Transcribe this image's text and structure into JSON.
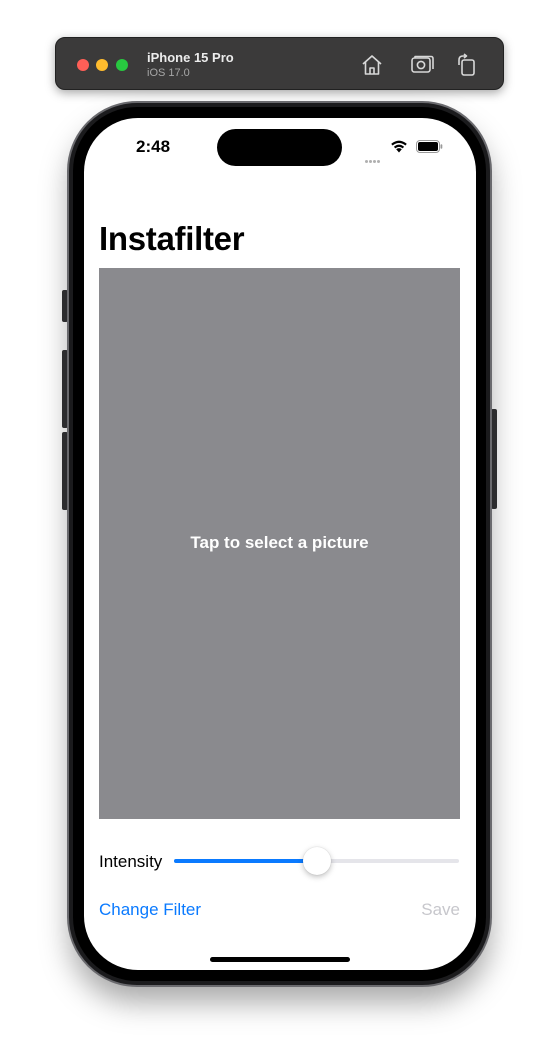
{
  "simulator": {
    "device_name": "iPhone 15 Pro",
    "os_version": "iOS 17.0",
    "toolbar_icons": [
      "home-icon",
      "screenshot-icon",
      "rotate-icon"
    ]
  },
  "status_bar": {
    "time": "2:48",
    "icons": [
      "signal-icon",
      "wifi-icon",
      "battery-icon"
    ]
  },
  "app": {
    "title": "Instafilter",
    "picture_prompt": "Tap to select a picture",
    "intensity_label": "Intensity",
    "intensity_value": 0.5,
    "change_filter_label": "Change Filter",
    "save_label": "Save"
  },
  "colors": {
    "accent": "#0a7aff",
    "placeholder_gray": "#8a8a8e",
    "disabled": "#c7c7cc"
  }
}
